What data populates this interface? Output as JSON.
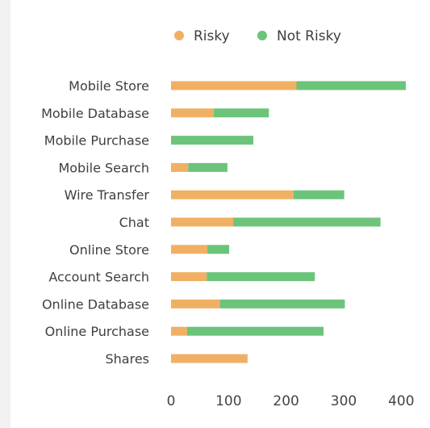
{
  "chart_data": {
    "type": "bar",
    "stacked": true,
    "orientation": "horizontal",
    "categories": [
      "Mobile Store",
      "Mobile Database",
      "Mobile Purchase",
      "Mobile Search",
      "Wire Transfer",
      "Chat",
      "Online Store",
      "Account Search",
      "Online Database",
      "Online Purchase",
      "Shares"
    ],
    "series": [
      {
        "name": "Risky",
        "color": "#f0b064",
        "values": [
          218,
          74,
          0,
          30,
          213,
          108,
          63,
          62,
          85,
          28,
          133
        ]
      },
      {
        "name": "Not Risky",
        "color": "#6cc47a",
        "values": [
          190,
          96,
          143,
          68,
          88,
          256,
          38,
          188,
          217,
          237,
          0
        ]
      }
    ],
    "xticks": [
      0,
      100,
      200,
      300,
      400
    ],
    "xlim": [
      0,
      420
    ],
    "legend_position": "top",
    "grid": false
  }
}
